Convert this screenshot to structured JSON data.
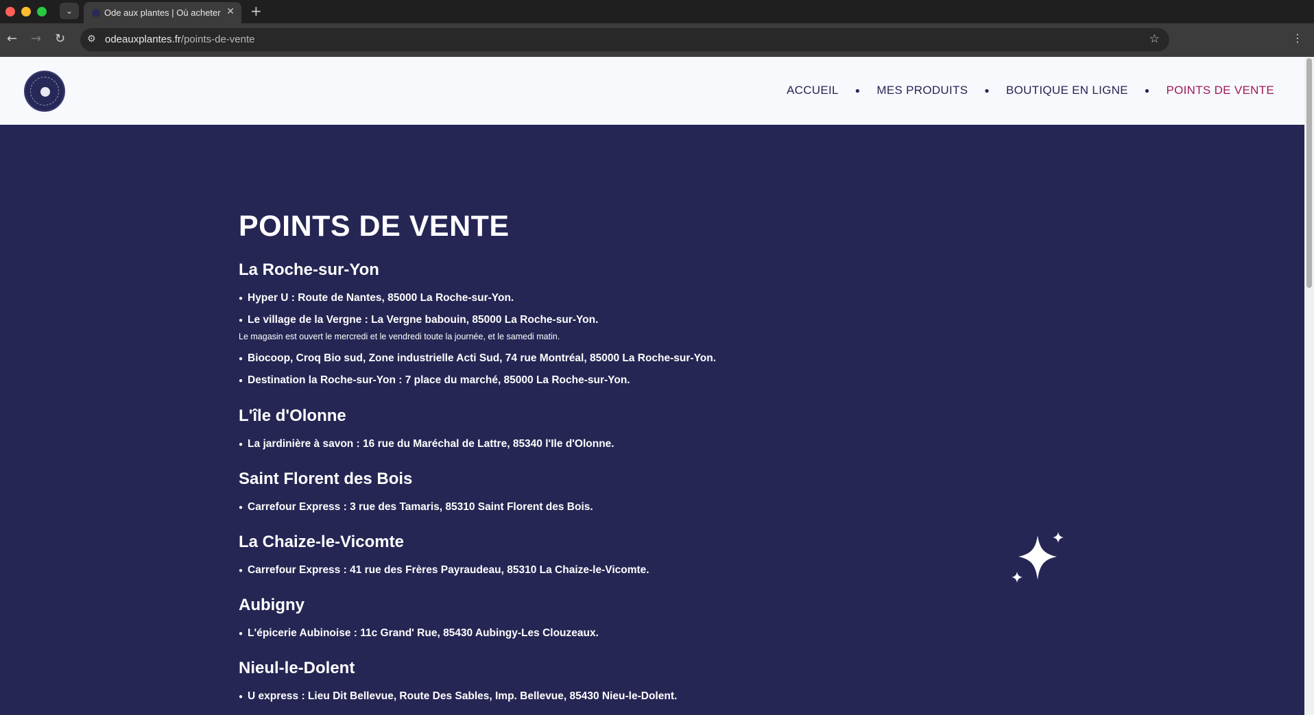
{
  "browser": {
    "tab_title": "Ode aux plantes | Où acheter",
    "url_host": "odeauxplantes.fr",
    "url_path": "/points-de-vente"
  },
  "nav": {
    "items": [
      {
        "label": "ACCUEIL"
      },
      {
        "label": "MES PRODUITS"
      },
      {
        "label": "BOUTIQUE EN LIGNE"
      },
      {
        "label": "POINTS DE VENTE"
      }
    ],
    "active_color": "#a0185a"
  },
  "page": {
    "title": "POINTS DE VENTE",
    "background_color": "#252654",
    "sections": [
      {
        "city": "La Roche-sur-Yon",
        "shops": [
          "Hyper U : Route de Nantes, 85000 La Roche-sur-Yon.",
          "Le village de la Vergne : La Vergne babouin, 85000 La Roche-sur-Yon.",
          "Biocoop, Croq Bio sud, Zone industrielle Acti Sud, 74 rue Montréal, 85000 La Roche-sur-Yon.",
          "Destination la Roche-sur-Yon : 7 place du marché, 85000 La Roche-sur-Yon."
        ],
        "note": "Le magasin est ouvert le mercredi et le vendredi toute la journée, et le samedi matin."
      },
      {
        "city": "L'île d'Olonne",
        "shops": [
          "La jardinière à savon : 16 rue du Maréchal de Lattre, 85340 l'Ile d'Olonne."
        ]
      },
      {
        "city": "Saint Florent des Bois",
        "shops": [
          "Carrefour Express : 3 rue des Tamaris, 85310 Saint Florent des Bois."
        ]
      },
      {
        "city": "La Chaize-le-Vicomte",
        "shops": [
          "Carrefour Express : 41 rue des Frères Payraudeau, 85310 La Chaize-le-Vicomte."
        ]
      },
      {
        "city": "Aubigny",
        "shops": [
          "L'épicerie Aubinoise : 11c Grand' Rue, 85430 Aubingy-Les Clouzeaux."
        ]
      },
      {
        "city": "Nieul-le-Dolent",
        "shops": [
          "U express : Lieu Dit Bellevue, Route Des Sables, Imp. Bellevue, 85430 Nieu-le-Dolent."
        ]
      }
    ]
  }
}
